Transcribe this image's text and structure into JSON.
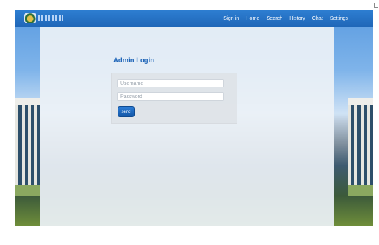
{
  "nav": {
    "logo": "logo",
    "items": [
      "Sign in",
      "Home",
      "Search",
      "History",
      "Chat",
      "Settings"
    ]
  },
  "login": {
    "title": "Admin Login",
    "username_placeholder": "Username",
    "password_placeholder": "Password",
    "submit_label": "send"
  },
  "colors": {
    "nav_bg": "#1f67b8",
    "title": "#1d64b8",
    "button": "#1558a8"
  }
}
